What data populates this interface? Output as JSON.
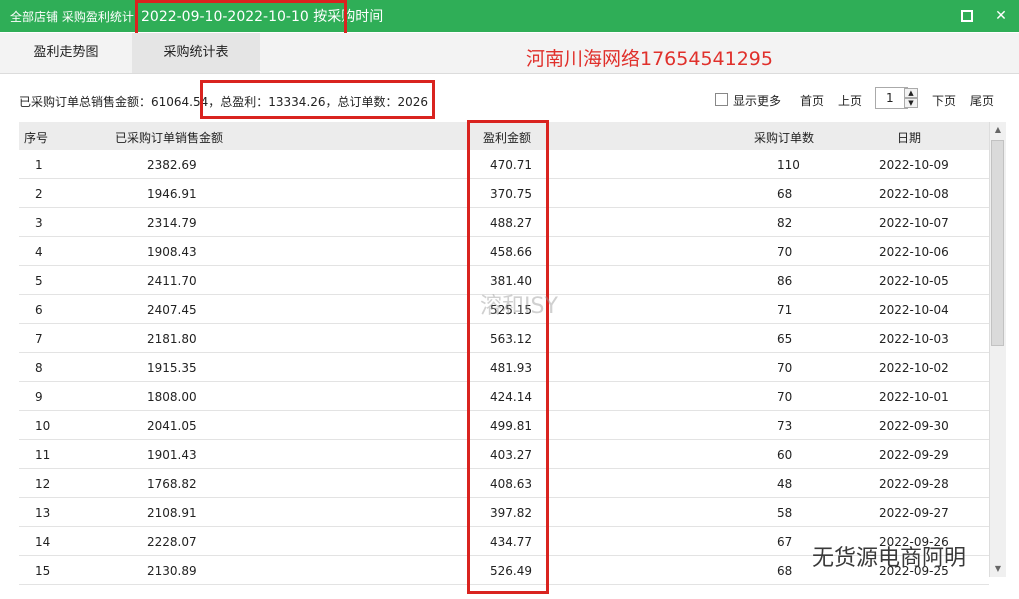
{
  "window": {
    "title_prefix": "全部店铺 采购盈利统计",
    "title_range": "2022-09-10-2022-10-10 按采购时间",
    "maximize_icon": "maximize-icon",
    "close_icon": "close-icon",
    "close_glyph": "✕"
  },
  "tabs": [
    {
      "label": "盈利走势图",
      "active": false
    },
    {
      "label": "采购统计表",
      "active": true
    }
  ],
  "summary": {
    "sales": "已采购订单总销售金额：61064.54",
    "profit": "，总盈利：13334.26，总订单数：2026"
  },
  "pager": {
    "show_more": "显示更多",
    "first": "首页",
    "prev": "上页",
    "page": "1",
    "next": "下页",
    "last": "尾页"
  },
  "table": {
    "headers": [
      "序号",
      "已采购订单销售金额",
      "盈利金额",
      "采购订单数",
      "日期"
    ],
    "rows": [
      [
        "1",
        "2382.69",
        "470.71",
        "110",
        "2022-10-09"
      ],
      [
        "2",
        "1946.91",
        "370.75",
        "68",
        "2022-10-08"
      ],
      [
        "3",
        "2314.79",
        "488.27",
        "82",
        "2022-10-07"
      ],
      [
        "4",
        "1908.43",
        "458.66",
        "70",
        "2022-10-06"
      ],
      [
        "5",
        "2411.70",
        "381.40",
        "86",
        "2022-10-05"
      ],
      [
        "6",
        "2407.45",
        "525.15",
        "71",
        "2022-10-04"
      ],
      [
        "7",
        "2181.80",
        "563.12",
        "65",
        "2022-10-03"
      ],
      [
        "8",
        "1915.35",
        "481.93",
        "70",
        "2022-10-02"
      ],
      [
        "9",
        "1808.00",
        "424.14",
        "70",
        "2022-10-01"
      ],
      [
        "10",
        "2041.05",
        "499.81",
        "73",
        "2022-09-30"
      ],
      [
        "11",
        "1901.43",
        "403.27",
        "60",
        "2022-09-29"
      ],
      [
        "12",
        "1768.82",
        "408.63",
        "48",
        "2022-09-28"
      ],
      [
        "13",
        "2108.91",
        "397.82",
        "58",
        "2022-09-27"
      ],
      [
        "14",
        "2228.07",
        "434.77",
        "67",
        "2022-09-26"
      ],
      [
        "15",
        "2130.89",
        "526.49",
        "68",
        "2022-09-25"
      ]
    ]
  },
  "watermarks": {
    "red_text": "河南川海网络17654541295",
    "weibo": "溶和ISY",
    "wechat": "无货源电商阿明"
  },
  "colors": {
    "titlebar": "#2fae57",
    "highlight_box": "#d9231f",
    "watermark": "#e0302b"
  }
}
